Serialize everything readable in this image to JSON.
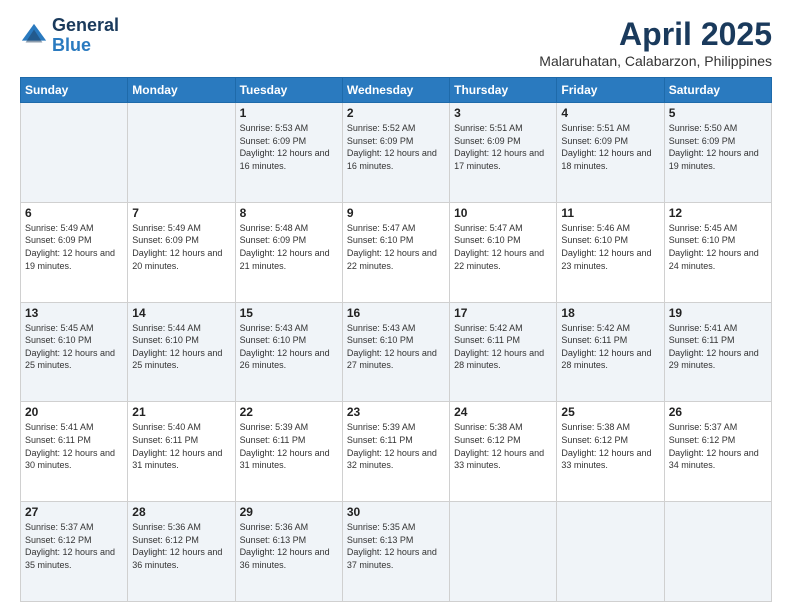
{
  "header": {
    "logo_general": "General",
    "logo_blue": "Blue",
    "month_title": "April 2025",
    "location": "Malaruhatan, Calabarzon, Philippines"
  },
  "days_of_week": [
    "Sunday",
    "Monday",
    "Tuesday",
    "Wednesday",
    "Thursday",
    "Friday",
    "Saturday"
  ],
  "weeks": [
    [
      {
        "day": "",
        "sunrise": "",
        "sunset": "",
        "daylight": ""
      },
      {
        "day": "",
        "sunrise": "",
        "sunset": "",
        "daylight": ""
      },
      {
        "day": "1",
        "sunrise": "Sunrise: 5:53 AM",
        "sunset": "Sunset: 6:09 PM",
        "daylight": "Daylight: 12 hours and 16 minutes."
      },
      {
        "day": "2",
        "sunrise": "Sunrise: 5:52 AM",
        "sunset": "Sunset: 6:09 PM",
        "daylight": "Daylight: 12 hours and 16 minutes."
      },
      {
        "day": "3",
        "sunrise": "Sunrise: 5:51 AM",
        "sunset": "Sunset: 6:09 PM",
        "daylight": "Daylight: 12 hours and 17 minutes."
      },
      {
        "day": "4",
        "sunrise": "Sunrise: 5:51 AM",
        "sunset": "Sunset: 6:09 PM",
        "daylight": "Daylight: 12 hours and 18 minutes."
      },
      {
        "day": "5",
        "sunrise": "Sunrise: 5:50 AM",
        "sunset": "Sunset: 6:09 PM",
        "daylight": "Daylight: 12 hours and 19 minutes."
      }
    ],
    [
      {
        "day": "6",
        "sunrise": "Sunrise: 5:49 AM",
        "sunset": "Sunset: 6:09 PM",
        "daylight": "Daylight: 12 hours and 19 minutes."
      },
      {
        "day": "7",
        "sunrise": "Sunrise: 5:49 AM",
        "sunset": "Sunset: 6:09 PM",
        "daylight": "Daylight: 12 hours and 20 minutes."
      },
      {
        "day": "8",
        "sunrise": "Sunrise: 5:48 AM",
        "sunset": "Sunset: 6:09 PM",
        "daylight": "Daylight: 12 hours and 21 minutes."
      },
      {
        "day": "9",
        "sunrise": "Sunrise: 5:47 AM",
        "sunset": "Sunset: 6:10 PM",
        "daylight": "Daylight: 12 hours and 22 minutes."
      },
      {
        "day": "10",
        "sunrise": "Sunrise: 5:47 AM",
        "sunset": "Sunset: 6:10 PM",
        "daylight": "Daylight: 12 hours and 22 minutes."
      },
      {
        "day": "11",
        "sunrise": "Sunrise: 5:46 AM",
        "sunset": "Sunset: 6:10 PM",
        "daylight": "Daylight: 12 hours and 23 minutes."
      },
      {
        "day": "12",
        "sunrise": "Sunrise: 5:45 AM",
        "sunset": "Sunset: 6:10 PM",
        "daylight": "Daylight: 12 hours and 24 minutes."
      }
    ],
    [
      {
        "day": "13",
        "sunrise": "Sunrise: 5:45 AM",
        "sunset": "Sunset: 6:10 PM",
        "daylight": "Daylight: 12 hours and 25 minutes."
      },
      {
        "day": "14",
        "sunrise": "Sunrise: 5:44 AM",
        "sunset": "Sunset: 6:10 PM",
        "daylight": "Daylight: 12 hours and 25 minutes."
      },
      {
        "day": "15",
        "sunrise": "Sunrise: 5:43 AM",
        "sunset": "Sunset: 6:10 PM",
        "daylight": "Daylight: 12 hours and 26 minutes."
      },
      {
        "day": "16",
        "sunrise": "Sunrise: 5:43 AM",
        "sunset": "Sunset: 6:10 PM",
        "daylight": "Daylight: 12 hours and 27 minutes."
      },
      {
        "day": "17",
        "sunrise": "Sunrise: 5:42 AM",
        "sunset": "Sunset: 6:11 PM",
        "daylight": "Daylight: 12 hours and 28 minutes."
      },
      {
        "day": "18",
        "sunrise": "Sunrise: 5:42 AM",
        "sunset": "Sunset: 6:11 PM",
        "daylight": "Daylight: 12 hours and 28 minutes."
      },
      {
        "day": "19",
        "sunrise": "Sunrise: 5:41 AM",
        "sunset": "Sunset: 6:11 PM",
        "daylight": "Daylight: 12 hours and 29 minutes."
      }
    ],
    [
      {
        "day": "20",
        "sunrise": "Sunrise: 5:41 AM",
        "sunset": "Sunset: 6:11 PM",
        "daylight": "Daylight: 12 hours and 30 minutes."
      },
      {
        "day": "21",
        "sunrise": "Sunrise: 5:40 AM",
        "sunset": "Sunset: 6:11 PM",
        "daylight": "Daylight: 12 hours and 31 minutes."
      },
      {
        "day": "22",
        "sunrise": "Sunrise: 5:39 AM",
        "sunset": "Sunset: 6:11 PM",
        "daylight": "Daylight: 12 hours and 31 minutes."
      },
      {
        "day": "23",
        "sunrise": "Sunrise: 5:39 AM",
        "sunset": "Sunset: 6:11 PM",
        "daylight": "Daylight: 12 hours and 32 minutes."
      },
      {
        "day": "24",
        "sunrise": "Sunrise: 5:38 AM",
        "sunset": "Sunset: 6:12 PM",
        "daylight": "Daylight: 12 hours and 33 minutes."
      },
      {
        "day": "25",
        "sunrise": "Sunrise: 5:38 AM",
        "sunset": "Sunset: 6:12 PM",
        "daylight": "Daylight: 12 hours and 33 minutes."
      },
      {
        "day": "26",
        "sunrise": "Sunrise: 5:37 AM",
        "sunset": "Sunset: 6:12 PM",
        "daylight": "Daylight: 12 hours and 34 minutes."
      }
    ],
    [
      {
        "day": "27",
        "sunrise": "Sunrise: 5:37 AM",
        "sunset": "Sunset: 6:12 PM",
        "daylight": "Daylight: 12 hours and 35 minutes."
      },
      {
        "day": "28",
        "sunrise": "Sunrise: 5:36 AM",
        "sunset": "Sunset: 6:12 PM",
        "daylight": "Daylight: 12 hours and 36 minutes."
      },
      {
        "day": "29",
        "sunrise": "Sunrise: 5:36 AM",
        "sunset": "Sunset: 6:13 PM",
        "daylight": "Daylight: 12 hours and 36 minutes."
      },
      {
        "day": "30",
        "sunrise": "Sunrise: 5:35 AM",
        "sunset": "Sunset: 6:13 PM",
        "daylight": "Daylight: 12 hours and 37 minutes."
      },
      {
        "day": "",
        "sunrise": "",
        "sunset": "",
        "daylight": ""
      },
      {
        "day": "",
        "sunrise": "",
        "sunset": "",
        "daylight": ""
      },
      {
        "day": "",
        "sunrise": "",
        "sunset": "",
        "daylight": ""
      }
    ]
  ]
}
